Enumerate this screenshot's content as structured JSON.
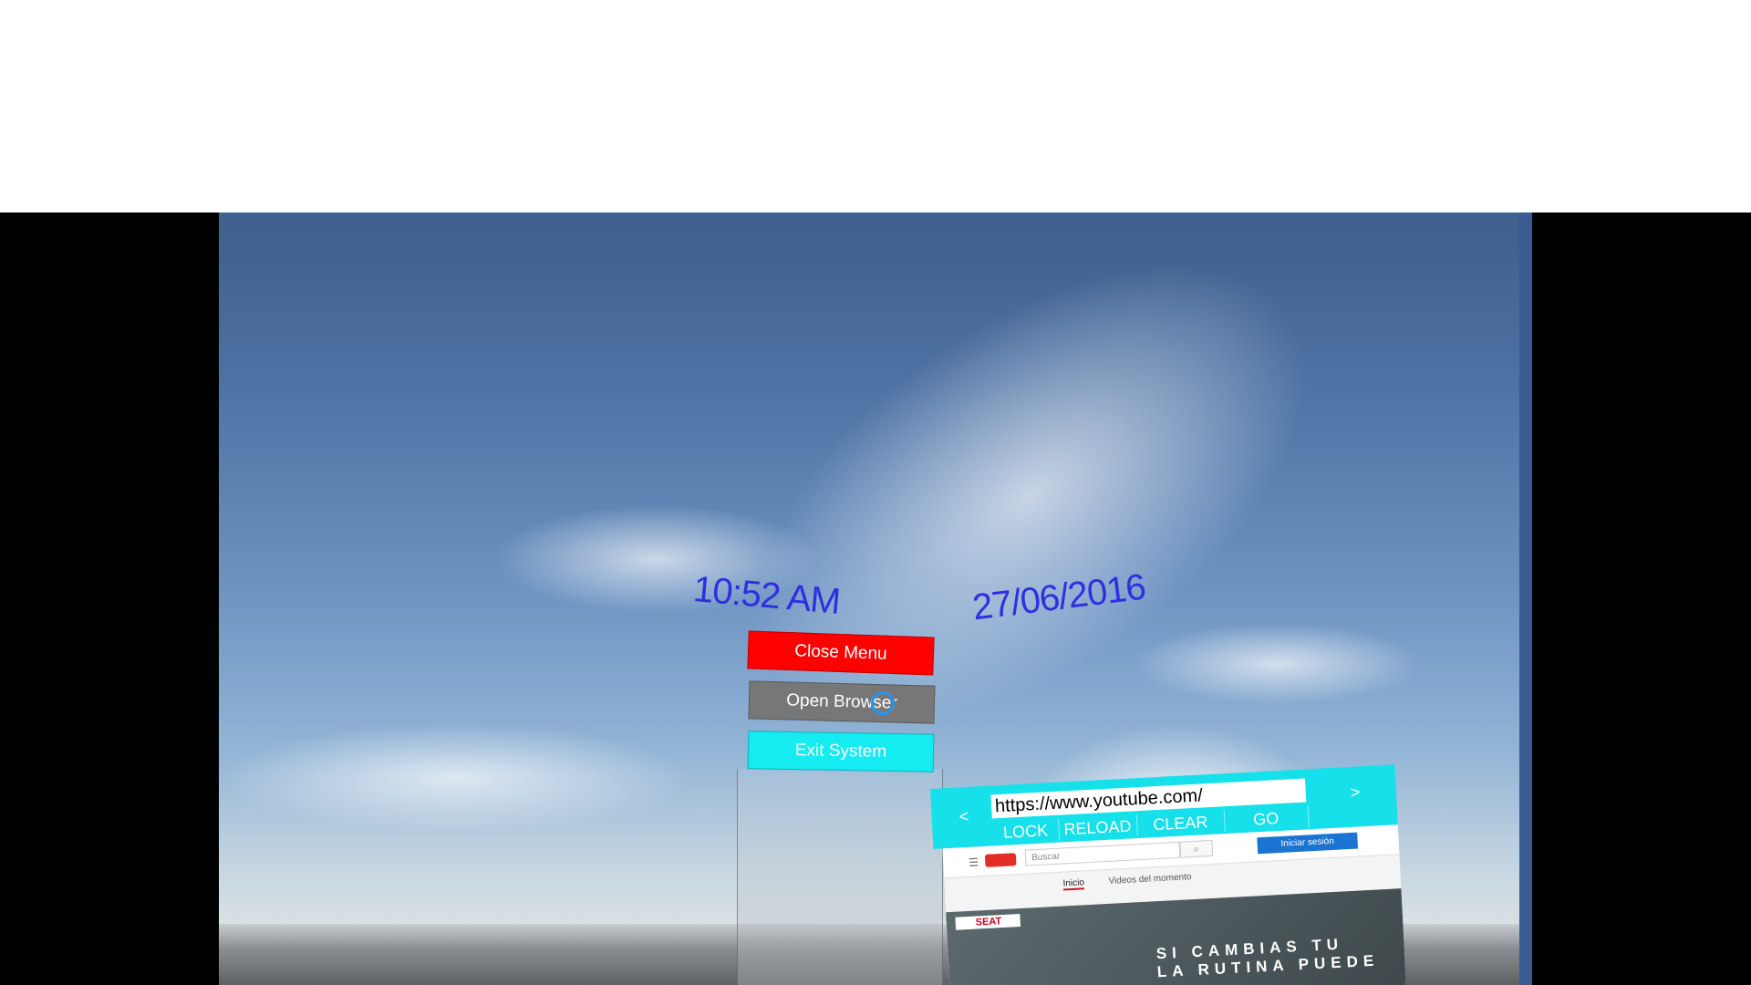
{
  "clock": {
    "time": "10:52 AM",
    "date": "27/06/2016"
  },
  "menu": {
    "close_label": "Close Menu",
    "open_browser_label": "Open Browser",
    "exit_label": "Exit System",
    "colors": {
      "close": "#ff0000",
      "open_browser": "#777777",
      "exit": "#14ecf2"
    }
  },
  "browser": {
    "back_label": "<",
    "forward_label": ">",
    "url": "https://www.youtube.com/",
    "buttons": {
      "lock": "LOCK",
      "reload": "RELOAD",
      "clear": "CLEAR",
      "go": "GO"
    },
    "accent": "#16e0ea",
    "page": {
      "search_placeholder": "Buscar",
      "login_label": "Iniciar sesión",
      "tabs": [
        "Inicio",
        "Videos del momento"
      ],
      "ad_brand": "SEAT",
      "ad_line1": "SI CAMBIAS TU",
      "ad_line2": "LA RUTINA PUEDE"
    }
  }
}
